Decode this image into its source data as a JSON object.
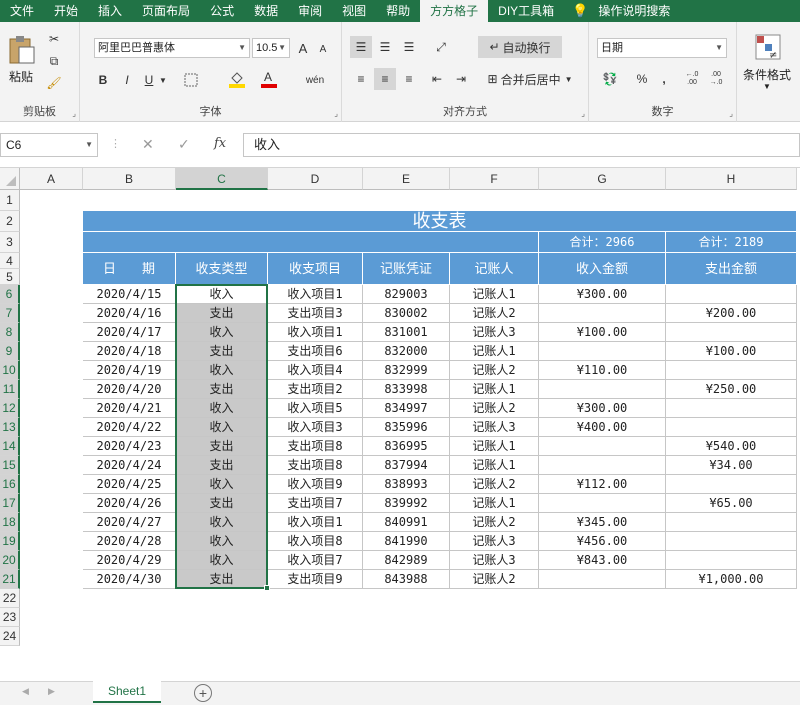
{
  "ribbon_tabs": [
    "文件",
    "开始",
    "插入",
    "页面布局",
    "公式",
    "数据",
    "审阅",
    "视图",
    "帮助",
    "方方格子",
    "DIY工具箱",
    "操作说明搜索"
  ],
  "active_tab": "方方格子",
  "clipboard": {
    "paste": "粘贴",
    "label": "剪贴板"
  },
  "font": {
    "name": "阿里巴巴普惠体",
    "size": "10.5",
    "label": "字体",
    "bold": "B",
    "italic": "I",
    "underline": "U",
    "grow": "A",
    "shrink": "A",
    "phonetic": "wén"
  },
  "alignment": {
    "wrap": "自动换行",
    "merge": "合并后居中",
    "label": "对齐方式"
  },
  "number": {
    "format": "日期",
    "percent": "%",
    "comma": ",",
    "inc_decimal": "←.0 .00",
    "dec_decimal": ".00 →.0",
    "label": "数字"
  },
  "styles": {
    "conditional": "条件格式"
  },
  "formula_bar": {
    "name_box": "C6",
    "cancel": "✕",
    "enter": "✓",
    "fx": "fx",
    "content": "收入"
  },
  "columns": [
    "A",
    "B",
    "C",
    "D",
    "E",
    "F",
    "G",
    "H"
  ],
  "rows": [
    "1",
    "2",
    "3",
    "4",
    "5",
    "6",
    "7",
    "8",
    "9",
    "10",
    "11",
    "12",
    "13",
    "14",
    "15",
    "16",
    "17",
    "18",
    "19",
    "20",
    "21",
    "22",
    "23",
    "24"
  ],
  "selected_column": "C",
  "selected_rows_range": "6-21",
  "table": {
    "title": "收支表",
    "total_income": "合计：2966",
    "total_expense": "合计：2189",
    "headers": [
      "日　　期",
      "收支类型",
      "收支项目",
      "记账凭证",
      "记账人",
      "收入金额",
      "支出金额"
    ],
    "rows": [
      [
        "2020/4/15",
        "收入",
        "收入项目1",
        "829003",
        "记账人1",
        "¥300.00",
        ""
      ],
      [
        "2020/4/16",
        "支出",
        "支出项目3",
        "830002",
        "记账人2",
        "",
        "¥200.00"
      ],
      [
        "2020/4/17",
        "收入",
        "收入项目1",
        "831001",
        "记账人3",
        "¥100.00",
        ""
      ],
      [
        "2020/4/18",
        "支出",
        "支出项目6",
        "832000",
        "记账人1",
        "",
        "¥100.00"
      ],
      [
        "2020/4/19",
        "收入",
        "收入项目4",
        "832999",
        "记账人2",
        "¥110.00",
        ""
      ],
      [
        "2020/4/20",
        "支出",
        "支出项目2",
        "833998",
        "记账人1",
        "",
        "¥250.00"
      ],
      [
        "2020/4/21",
        "收入",
        "收入项目5",
        "834997",
        "记账人2",
        "¥300.00",
        ""
      ],
      [
        "2020/4/22",
        "收入",
        "收入项目3",
        "835996",
        "记账人3",
        "¥400.00",
        ""
      ],
      [
        "2020/4/23",
        "支出",
        "支出项目8",
        "836995",
        "记账人1",
        "",
        "¥540.00"
      ],
      [
        "2020/4/24",
        "支出",
        "支出项目8",
        "837994",
        "记账人1",
        "",
        "¥34.00"
      ],
      [
        "2020/4/25",
        "收入",
        "收入项目9",
        "838993",
        "记账人2",
        "¥112.00",
        ""
      ],
      [
        "2020/4/26",
        "支出",
        "支出项目7",
        "839992",
        "记账人1",
        "",
        "¥65.00"
      ],
      [
        "2020/4/27",
        "收入",
        "收入项目1",
        "840991",
        "记账人2",
        "¥345.00",
        ""
      ],
      [
        "2020/4/28",
        "收入",
        "收入项目8",
        "841990",
        "记账人3",
        "¥456.00",
        ""
      ],
      [
        "2020/4/29",
        "收入",
        "收入项目7",
        "842989",
        "记账人3",
        "¥843.00",
        ""
      ],
      [
        "2020/4/30",
        "支出",
        "支出项目9",
        "843988",
        "记账人2",
        "",
        "¥1,000.00"
      ]
    ]
  },
  "sheet": {
    "name": "Sheet1",
    "add": "+"
  },
  "colors": {
    "excel_green": "#217346",
    "table_blue": "#5b9bd5",
    "selection_grey": "#c9c9c9"
  }
}
